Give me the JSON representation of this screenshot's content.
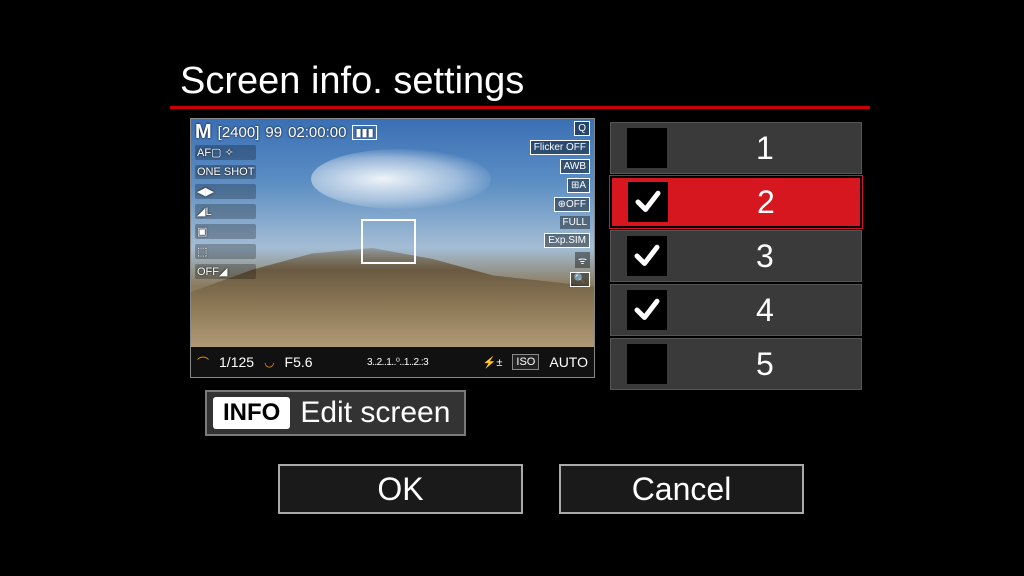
{
  "title": "Screen info. settings",
  "preview": {
    "mode": "M",
    "bracket": "[2400]",
    "shots": "99",
    "time": "02:00:00",
    "left_icons": [
      "AF▢ ✧",
      "ONE SHOT",
      "◀▶",
      "◢L",
      "▣",
      "⬚",
      "OFF◢"
    ],
    "right_icons": [
      "Q",
      "Flicker OFF",
      "AWB",
      "⊞A",
      "⊕OFF",
      "FULL",
      "Exp.SIM",
      "ᯤ",
      "🔍"
    ],
    "shutter": "1/125",
    "aperture": "F5.6",
    "meter": "3..2..1..⁰..1..2.:3",
    "iso_label": "ISO",
    "iso_value": "AUTO"
  },
  "edit": {
    "badge": "INFO",
    "label": "Edit screen"
  },
  "list": [
    {
      "num": "1",
      "checked": false,
      "selected": false
    },
    {
      "num": "2",
      "checked": true,
      "selected": true
    },
    {
      "num": "3",
      "checked": true,
      "selected": false
    },
    {
      "num": "4",
      "checked": true,
      "selected": false
    },
    {
      "num": "5",
      "checked": false,
      "selected": false
    }
  ],
  "ok_label": "OK",
  "cancel_label": "Cancel"
}
